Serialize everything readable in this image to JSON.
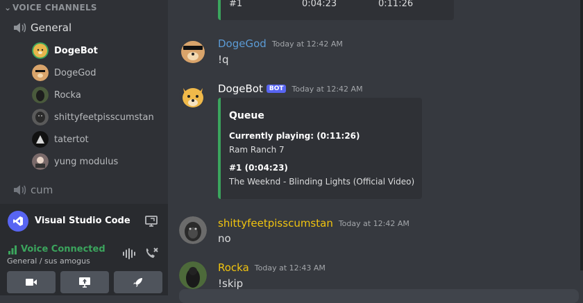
{
  "sidebar": {
    "voice_header": "VOICE CHANNELS",
    "channel_general": "General",
    "channel_cum": "cum",
    "voice_users": [
      {
        "name": "DogeBot",
        "active": true
      },
      {
        "name": "DogeGod",
        "active": false
      },
      {
        "name": "Rocka",
        "active": false
      },
      {
        "name": "shittyfeetpisscumstan",
        "active": false
      },
      {
        "name": "tatertot",
        "active": false
      },
      {
        "name": "yung modulus",
        "active": false
      }
    ]
  },
  "activity": {
    "label": "Visual Studio Code"
  },
  "voice_panel": {
    "status": "Voice Connected",
    "sub": "General / sus amogus"
  },
  "chat": {
    "top_embed": {
      "num": "#1",
      "t1": "0:04:23",
      "t2": "0:11:26"
    },
    "messages": [
      {
        "author": "DogeGod",
        "time": "Today at 12:42 AM",
        "text": "!q",
        "color": "#5b9bd5"
      },
      {
        "author": "DogeBot",
        "badge": "BOT",
        "time": "Today at 12:42 AM",
        "color": "#ffffff"
      },
      {
        "author": "shittyfeetpisscumstan",
        "time": "Today at 12:42 AM",
        "text": "no",
        "color": "#f1c40f"
      },
      {
        "author": "Rocka",
        "time": "Today at 12:43 AM",
        "text": "!skip",
        "color": "#f1c40f"
      }
    ],
    "embed": {
      "title": "Queue",
      "f1_name": "Currently playing:  (0:11:26)",
      "f1_value": "Ram Ranch 7",
      "f2_name": "#1  (0:04:23)",
      "f2_value": "The Weeknd - Blinding Lights (Official Video)"
    }
  },
  "colors": {
    "accent": "#5865f2",
    "green": "#3ba55d",
    "bg": "#36393f",
    "sidebar": "#2f3136"
  }
}
